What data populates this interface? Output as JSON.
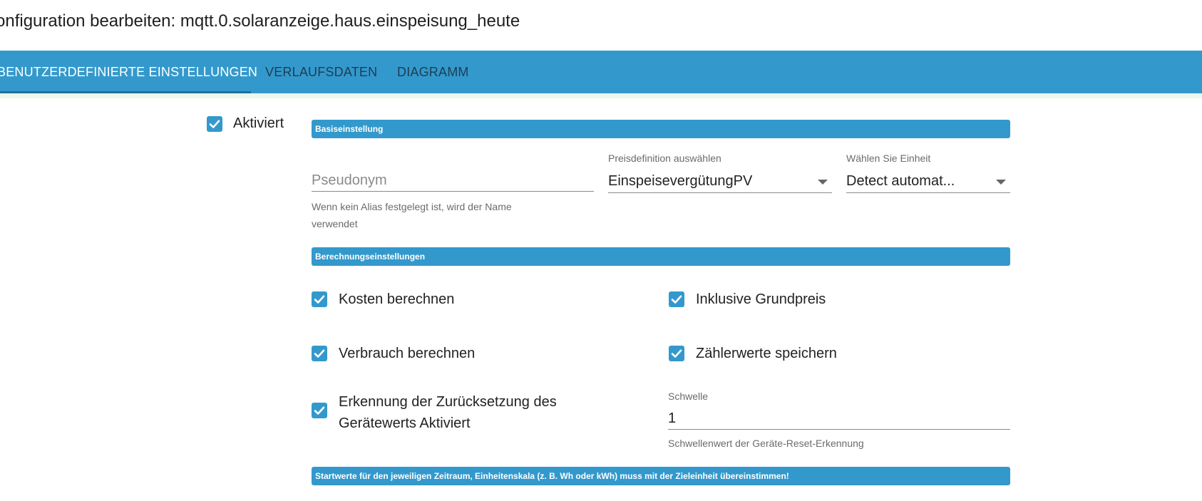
{
  "window": {
    "title": "onfiguration bearbeiten: mqtt.0.solaranzeige.haus.einspeisung_heute"
  },
  "tabs": [
    {
      "label": "BENUTZERDEFINIERTE EINSTELLUNGEN",
      "active": true
    },
    {
      "label": "VERLAUFSDATEN",
      "active": false
    },
    {
      "label": "DIAGRAMM",
      "active": false
    }
  ],
  "enabled": {
    "label": "Aktiviert",
    "checked": true
  },
  "basic": {
    "header": "Basiseinstellung",
    "alias": {
      "placeholder": "Pseudonym",
      "value": "",
      "help_line1": "Wenn kein Alias festgelegt ist, wird der Name",
      "help_line2": "verwendet"
    },
    "price": {
      "label": "Preisdefinition auswählen",
      "value": "EinspeisevergütungPV"
    },
    "unit": {
      "label": "Wählen Sie Einheit",
      "value": "Detect automat..."
    }
  },
  "calc": {
    "header": "Berechnungseinstellungen",
    "costs": {
      "label": "Kosten berechnen",
      "checked": true
    },
    "base_price": {
      "label": "Inklusive Grundpreis",
      "checked": true
    },
    "consumption": {
      "label": "Verbrauch berechnen",
      "checked": true
    },
    "meter_values": {
      "label": "Zählerwerte speichern",
      "checked": true
    },
    "reset_detection": {
      "label_line1": "Erkennung der Zurücksetzung des",
      "label_line2": "Gerätewerts Aktiviert",
      "checked": true
    },
    "threshold": {
      "label": "Schwelle",
      "value": "1",
      "help": "Schwellenwert der Geräte-Reset-Erkennung"
    }
  },
  "start_values": {
    "header": "Startwerte für den jeweiligen Zeitraum, Einheitenskala (z. B. Wh oder kWh) muss mit der Zieleinheit übereinstimmen!"
  },
  "colors": {
    "primary": "#3399cc",
    "tab_text_inactive": "#1e3d55",
    "tab_indicator": "#1e6f99"
  }
}
